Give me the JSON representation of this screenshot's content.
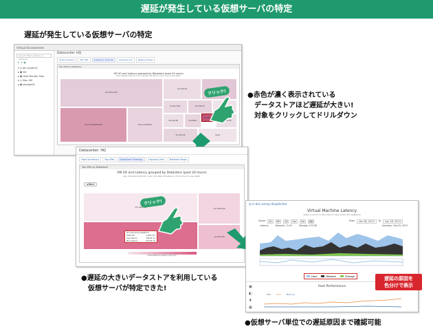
{
  "banner": "遅延が発生している仮想サーバの特定",
  "subtitle": "遅延が発生している仮想サーバの特定",
  "notes": {
    "note1_lines": [
      "●赤色が濃く表示されている",
      "データストアほど遅延が大きい!",
      "対象をクリックしてドリルダウン"
    ],
    "note2_lines": [
      "●遅延の大きいデータストアを利用している",
      "仮想サーバが特定できた!"
    ],
    "note3": "●仮想サーバ単位での遅延原因まで確認可能",
    "red_callout_lines": [
      "遅延の原因を",
      "色分けで表示"
    ],
    "click_label": "クリック!"
  },
  "shot1": {
    "window_title": "Virtual Environment",
    "search_placeholder": "Search VMs by Name or Attribute",
    "tools": "⊕ ⊘ ▣",
    "tree": [
      "▾ ◎ db-cluster01",
      "  ▸ ▦ DS",
      "  ▸ ▦ Host Monitor Pool",
      "▾ ◎ Mon VM",
      "  ▸ ▦ storage01"
    ],
    "title": "Datacenter: HQ",
    "tabs": [
      "Host Summary",
      "Top VMs",
      "Datastore Treemap",
      "Capacity Info",
      "Network Maps"
    ],
    "panel_header": "Top VMs by Datastore",
    "panel_title": "VM I/O and Latency grouped by Datastore (past 24 hours)",
    "panel_note": "size indicates total I/O, color indicates VM latency. Click a box to see detail.",
    "cells": [
      "ds-vmfs-lun02",
      "ds-vmfs-datastore01",
      "ds-lun-cluster01",
      "ds-vmfs-03",
      "ds-vmfs-04",
      "ds-dev-vmfs",
      "ds-vmfs-05",
      "ds-nfs01",
      "ds-vmfs-06",
      "ds-test01",
      "ds-vmfs-07",
      "ds-vmfs-08",
      "ds-vmfs-09",
      "ds-iso"
    ]
  },
  "shot2": {
    "title": "Datacenter: HQ",
    "tabs": [
      "Host Summary",
      "Top VMs",
      "Datastore Treemap",
      "Capacity Info",
      "Network Maps"
    ],
    "panel_header": "Top VMs by Datastore",
    "panel_title": "VM I/O and Latency grouped by Datastore (past 24 hours)",
    "panel_note": "size indicates total I/O, color indicates VM latency. Click a box to see detail.",
    "back_label": "◂ Back",
    "cells": [
      "vm-app-01",
      "vm-db-02",
      "vm-web-03",
      "vm-file-04"
    ],
    "legend": "Virtual Machine Latency (avg ms)",
    "tip": {
      "name": "db-d-sql-array-dispatcher",
      "rows": [
        [
          "Total I/Os",
          "4,063,211"
        ],
        [
          "Avg Latency",
          "148.92 ms"
        ],
        [
          "Max Latency",
          "527.83 ms"
        ]
      ]
    }
  },
  "shot3": {
    "vm_name": "◎ k-dsc-array-dispatcher",
    "chart_title": "Virtual Machine Latency",
    "chart_note": "Select a point on the chart to view active VM neighbors",
    "zoom_label": "Zoom",
    "zoom_buttons": [
      "1h",
      "6h",
      "1d",
      "1w",
      "1m",
      "All"
    ],
    "from_label": "From",
    "from": "Jan 18, 2013",
    "to_label": "To",
    "to": "Apr 18, 2013",
    "stats": {
      "latency": "Latency",
      "network": "Network: 11.91",
      "storage": "Storage: 133.58",
      "date": "Saturday, Feb 16, 2013"
    },
    "legend": [
      "Host",
      "Network",
      "Storage"
    ],
    "host_title": "Host Performance",
    "host_date": "Saturday, Mar 9, 2013",
    "host_legend": [
      "CPU",
      "Disk",
      "Memory"
    ],
    "icons": [
      "▣",
      "◧",
      "♜",
      "▦"
    ]
  },
  "colors": {
    "banner": "#1f9a6e",
    "accent_red": "#d8262e",
    "treemap_light": "#eadbe4",
    "treemap_dark": "#d77a98"
  }
}
